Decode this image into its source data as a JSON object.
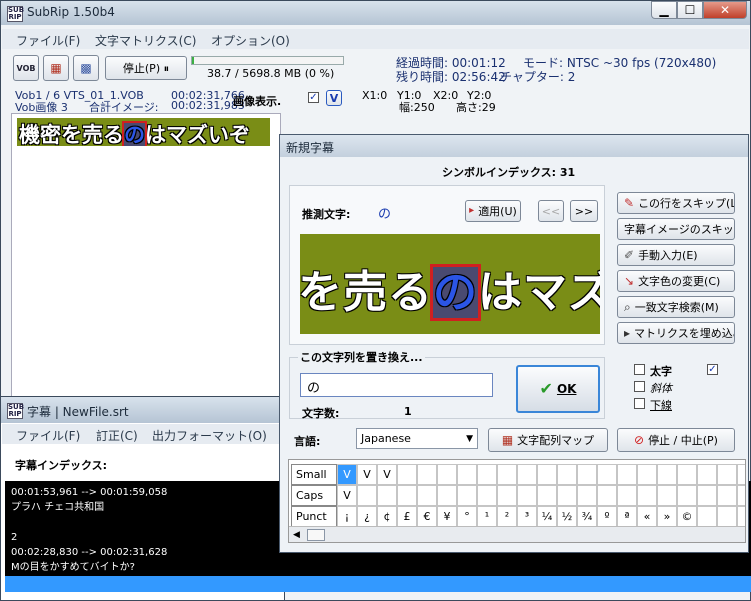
{
  "subrip": {
    "title": "SubRip 1.50b4",
    "menu": [
      "ファイル(F)",
      "文字マトリクス(C)",
      "オプション(O)"
    ],
    "toolbar": {
      "vob_label": "VOB",
      "stop_label": "停止(P) ⏸",
      "progress_text": "38.7 / 5698.8 MB (0 %)",
      "progress_fraction": 0.0068
    },
    "status": {
      "elapsed": "経過時間: 00:01:12",
      "remaining": "残り時間: 02:56:42",
      "mode": "モード: NTSC ~30 fps (720x480)",
      "chapter": "チャプター: 2"
    },
    "info": {
      "vob": "Vob1 / 6  VTS_01_1.VOB",
      "vob_time": "00:02:31,766",
      "vob_image": "Vob画像 3",
      "total_images": "合計イメージ:",
      "total_time": "00:02:31,983",
      "show_image": "画像表示.",
      "v_label": "V",
      "x1": "X1:0",
      "y1": "Y1:0",
      "x2": "X2:0",
      "y2": "Y2:0",
      "width": "幅:250",
      "height": "高さ:29"
    },
    "preview_text_a": "機密を売る",
    "preview_highlight": "の",
    "preview_text_b": "はマズいぞ"
  },
  "srtwin": {
    "title": "字幕 | NewFile.srt",
    "menu": [
      "ファイル(F)",
      "訂正(C)",
      "出力フォーマット(O)"
    ],
    "index_label": "字幕インデックス:",
    "lines": [
      "00:01:53,961 --> 00:01:59,058",
      "プラハ チェコ共和国",
      "",
      "2",
      "00:02:28,830 --> 00:02:31,628",
      "Mの目をかすめてバイトか?"
    ]
  },
  "dialog": {
    "title": "新規字幕",
    "symbol_index": "シンボルインデックス: 31",
    "guess_label": "推測文字:",
    "guess_char": "の",
    "apply_label": "適用(U)",
    "prev_label": "<<",
    "next_label": ">>",
    "crop_text_a": "を売る",
    "crop_highlight": "の",
    "crop_text_b": "はマズ",
    "replace_group_label": "この文字列を置き換え...",
    "replace_value": "の",
    "char_count_label": "文字数:",
    "char_count": "1",
    "ok_label": "OK",
    "side_buttons": [
      "この行をスキップ(L)",
      "字幕イメージのスキップ",
      "手動入力(E)",
      "文字色の変更(C)",
      "一致文字検索(M)",
      "マトリクスを埋め込み"
    ],
    "checkboxes": {
      "bold": "太字",
      "italic": "斜体",
      "underline": "下線",
      "v_check": "✓"
    },
    "language_label": "言語:",
    "language_value": "Japanese",
    "map_button": "文字配列マップ",
    "stop_button": "停止 / 中止(P)",
    "rows": [
      {
        "name": "Small",
        "cells": [
          "V",
          "V",
          "V",
          "",
          "",
          "",
          "",
          "",
          "",
          "",
          "",
          "",
          "",
          "",
          "",
          "",
          "",
          "",
          "",
          "",
          ""
        ]
      },
      {
        "name": "Caps",
        "cells": [
          "V",
          "",
          "",
          "",
          "",
          "",
          "",
          "",
          "",
          "",
          "",
          "",
          "",
          "",
          "",
          "",
          "",
          "",
          "",
          "",
          ""
        ]
      },
      {
        "name": "Punct",
        "cells": [
          "¡",
          "¿",
          "¢",
          "£",
          "€",
          "¥",
          "°",
          "¹",
          "²",
          "³",
          "¼",
          "½",
          "¾",
          "º",
          "ª",
          "«",
          "»",
          "©",
          "",
          "",
          ""
        ]
      }
    ]
  },
  "colors": {
    "accent": "#1a3cb0",
    "subtitle_bg": "#7a8d16",
    "highlight_red": "#d02020"
  }
}
